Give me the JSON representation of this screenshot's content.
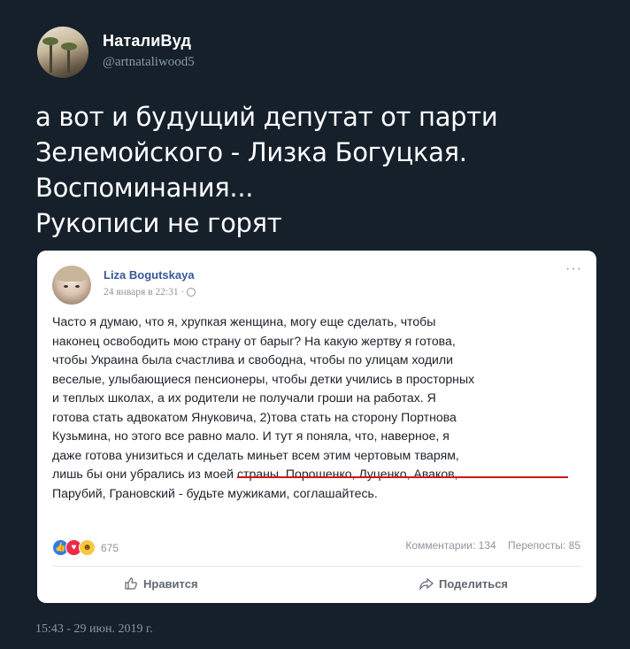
{
  "tweet": {
    "display_name": "НаталиВуд",
    "handle": "@artnataliwood5",
    "text": "а вот и будущий депутат от парти\nЗелемойского - Лизка Богуцкая.\nВоспоминания...\nРукописи не горят",
    "timestamp": "15:43 - 29 июн. 2019 г."
  },
  "fb_post": {
    "author": "Liza Bogutskaya",
    "date": "24 января в 22:31 · ",
    "more_label": "···",
    "body_lines": [
      "Часто я думаю, что я, хрупкая женщина, могу еще сделать, чтобы",
      "наконец освободить мою страну от барыг? На какую жертву я готова,",
      "чтобы Украина была счастлива и свободна, чтобы по улицам ходили",
      "веселые, улыбающиеся пенсионеры, чтобы детки учились в просторных",
      "и теплых школах, а их родители не получали гроши на работах. Я",
      "готова стать адвокатом Януковича, 2)това стать на сторону Портнова",
      "Кузьмина, но этого все равно мало. И тут я поняла, что, наверное, я",
      "даже готова унизиться и сделать миньет всем этим чертовым тварям,",
      "лишь бы они убрались из моей страны. Порошенко, Луценко, Аваков,",
      "Парубий, Грановский - будьте мужиками, соглашайтесь."
    ],
    "reactions_count": "675",
    "comments": "Комментарии: 134",
    "shares": "Перепосты: 85",
    "like_label": "Нравится",
    "share_label": "Поделиться"
  },
  "colors": {
    "background": "#15202b",
    "fb_link": "#385898",
    "underline": "#d01818"
  }
}
